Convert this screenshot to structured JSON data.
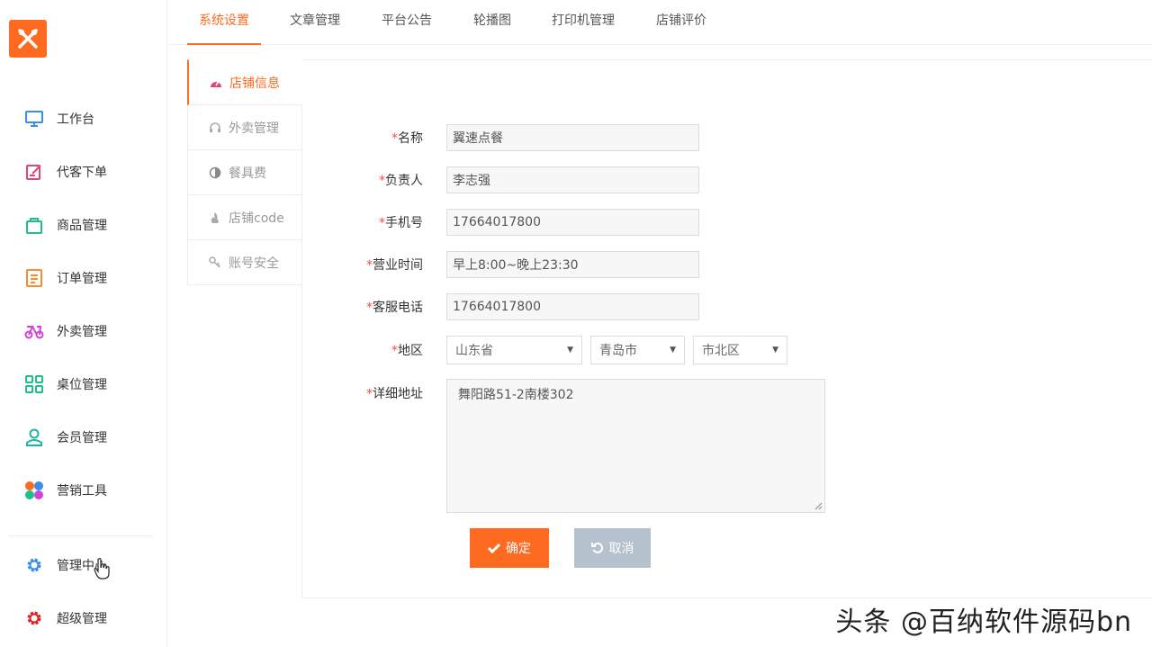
{
  "sidebar": {
    "logo_icon": "fork-knife-icon",
    "items": [
      {
        "label": "工作台",
        "icon": "monitor-icon",
        "color": "#3a8ee6"
      },
      {
        "label": "代客下单",
        "icon": "edit-icon",
        "color": "#e0447a"
      },
      {
        "label": "商品管理",
        "icon": "bag-icon",
        "color": "#1cc08a"
      },
      {
        "label": "订单管理",
        "icon": "order-list-icon",
        "color": "#ff8a2b"
      },
      {
        "label": "外卖管理",
        "icon": "scooter-icon",
        "color": "#d045d8"
      },
      {
        "label": "桌位管理",
        "icon": "grid-icon",
        "color": "#1cc08a"
      },
      {
        "label": "会员管理",
        "icon": "user-icon",
        "color": "#1cb5a0"
      },
      {
        "label": "营销工具",
        "icon": "petals-icon",
        "color": "#ff6a21"
      }
    ],
    "bottom_items": [
      {
        "label": "管理中心",
        "icon": "gear-icon",
        "color": "#3a8ee6"
      },
      {
        "label": "超级管理",
        "icon": "gear-icon",
        "color": "#e02020"
      }
    ]
  },
  "tabs": [
    {
      "label": "系统设置",
      "active": true
    },
    {
      "label": "文章管理",
      "active": false
    },
    {
      "label": "平台公告",
      "active": false
    },
    {
      "label": "轮播图",
      "active": false
    },
    {
      "label": "打印机管理",
      "active": false
    },
    {
      "label": "店铺评价",
      "active": false
    }
  ],
  "subnav": [
    {
      "label": "店铺信息",
      "icon": "dashboard-icon",
      "active": true
    },
    {
      "label": "外卖管理",
      "icon": "headset-icon",
      "active": false
    },
    {
      "label": "餐具费",
      "icon": "half-circle-icon",
      "active": false
    },
    {
      "label": "店铺code",
      "icon": "flame-icon",
      "active": false
    },
    {
      "label": "账号安全",
      "icon": "key-icon",
      "active": false
    }
  ],
  "form": {
    "name": {
      "label": "名称",
      "value": "翼速点餐"
    },
    "owner": {
      "label": "负责人",
      "value": "李志强"
    },
    "phone": {
      "label": "手机号",
      "value": "17664017800"
    },
    "hours": {
      "label": "营业时间",
      "value": "早上8:00~晚上23:30"
    },
    "service_phone": {
      "label": "客服电话",
      "value": "17664017800"
    },
    "region": {
      "label": "地区",
      "province": "山东省",
      "city": "青岛市",
      "district": "市北区"
    },
    "address": {
      "label": "详细地址",
      "value": "舞阳路51-2南楼302"
    },
    "required_mark": "*"
  },
  "buttons": {
    "confirm": "确定",
    "cancel": "取消"
  },
  "watermark": "头条 @百纳软件源码bn",
  "colors": {
    "accent": "#ff6a21",
    "cancel_bg": "#b5c1cc"
  }
}
